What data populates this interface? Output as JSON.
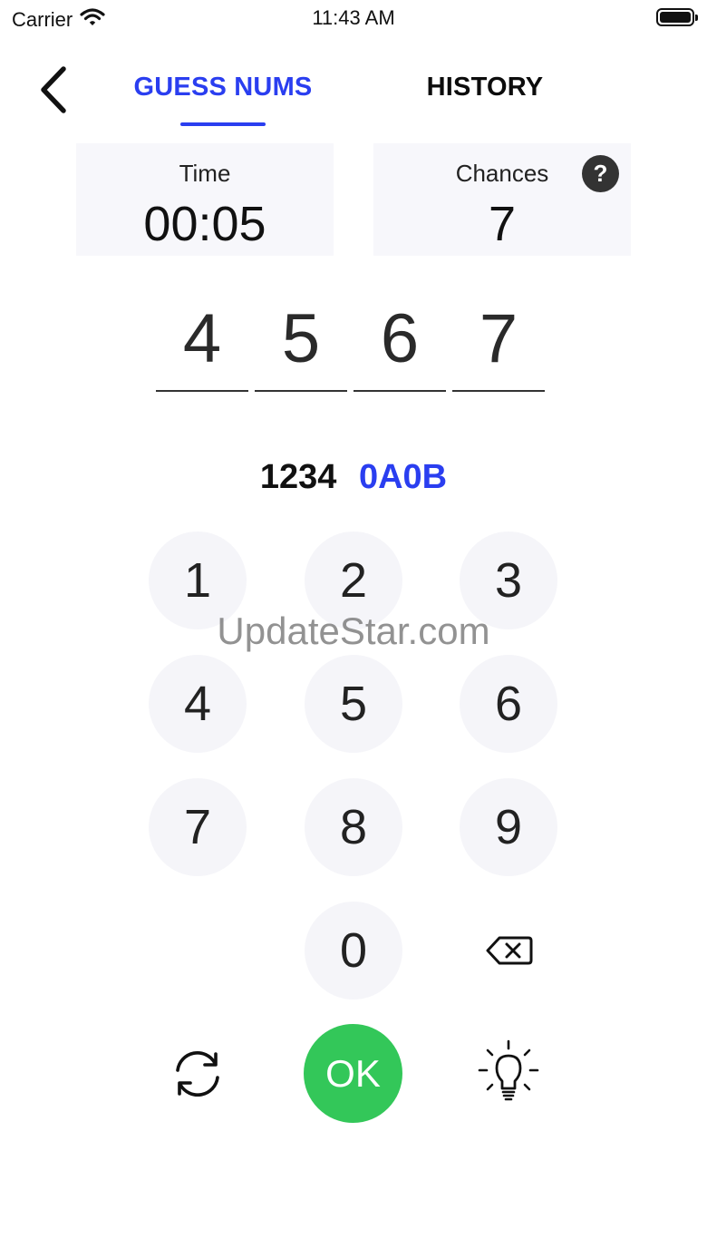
{
  "status_bar": {
    "carrier": "Carrier",
    "time": "11:43 AM"
  },
  "nav": {
    "tab_guess": "GUESS NUMS",
    "tab_history": "HISTORY",
    "active_tab": "GUESS NUMS"
  },
  "stats": {
    "time_label": "Time",
    "time_value": "00:05",
    "chances_label": "Chances",
    "chances_value": "7",
    "help_symbol": "?"
  },
  "guess": {
    "digits": [
      "4",
      "5",
      "6",
      "7"
    ]
  },
  "last_result": {
    "guess": "1234",
    "score": "0A0B"
  },
  "keypad": {
    "keys": [
      "1",
      "2",
      "3",
      "4",
      "5",
      "6",
      "7",
      "8",
      "9",
      "0"
    ],
    "ok_label": "OK"
  },
  "watermark": "UpdateStar.com",
  "colors": {
    "accent": "#2a3ef0",
    "ok_green": "#33c759",
    "key_bg": "#f5f5f9",
    "card_bg": "#f7f7fb"
  },
  "icons": {
    "back": "chevron-left-icon",
    "help": "question-circle-icon",
    "backspace": "backspace-icon",
    "refresh": "refresh-icon",
    "hint": "lightbulb-icon",
    "wifi": "wifi-icon",
    "battery": "battery-icon"
  }
}
